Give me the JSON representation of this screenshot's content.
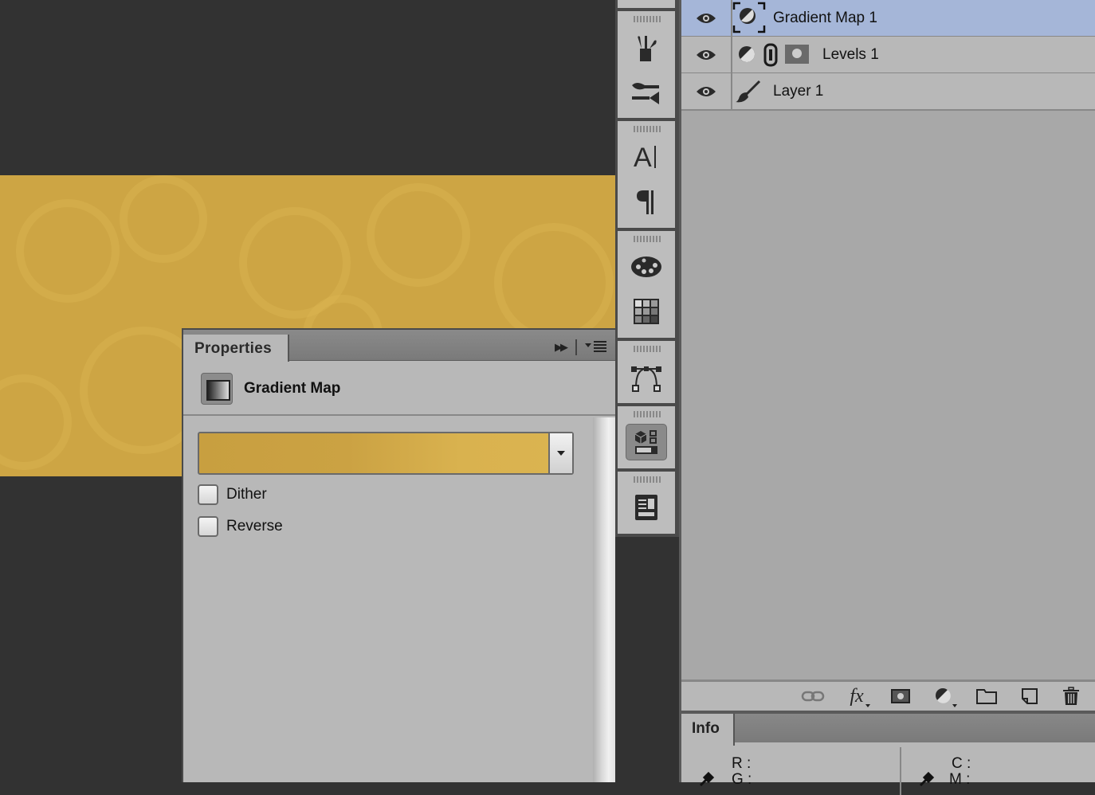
{
  "canvas": {
    "image_color": "#cda544"
  },
  "properties_panel": {
    "tab_label": "Properties",
    "collapse_icon": "double-arrow-right-icon",
    "menu_icon": "panel-menu-icon",
    "header": {
      "icon": "gradient-map-icon",
      "title": "Gradient Map"
    },
    "gradient": {
      "start_color": "#c89f40",
      "end_color": "#dbb450"
    },
    "options": [
      {
        "label": "Dither",
        "checked": false
      },
      {
        "label": "Reverse",
        "checked": false
      }
    ]
  },
  "dock": {
    "groups": [
      {
        "buttons": [
          "brush-presets-icon",
          "brush-panel-icon"
        ]
      },
      {
        "buttons": [
          "character-icon",
          "paragraph-icon"
        ]
      },
      {
        "buttons": [
          "color-palette-icon",
          "swatches-icon"
        ]
      },
      {
        "buttons": [
          "paths-icon"
        ]
      },
      {
        "buttons": [
          "properties-icon"
        ],
        "active": true
      },
      {
        "buttons": [
          "notes-icon"
        ]
      }
    ]
  },
  "layers": {
    "items": [
      {
        "name": "Gradient Map 1",
        "visible": true,
        "selected": true,
        "type": "adjustment"
      },
      {
        "name": "Levels 1",
        "visible": true,
        "selected": false,
        "type": "adjustment-masked"
      },
      {
        "name": "Layer 1",
        "visible": true,
        "selected": false,
        "type": "pixel"
      }
    ],
    "footer_icons": [
      "link-layers-icon",
      "fx-icon",
      "add-mask-icon",
      "adjustment-layer-icon",
      "group-folder-icon",
      "new-layer-icon",
      "trash-icon"
    ],
    "footer_fx_label": "fx"
  },
  "info_panel": {
    "tab_label": "Info",
    "left_labels": [
      "R :",
      "G :"
    ],
    "right_labels": [
      "C :",
      "M :"
    ]
  }
}
